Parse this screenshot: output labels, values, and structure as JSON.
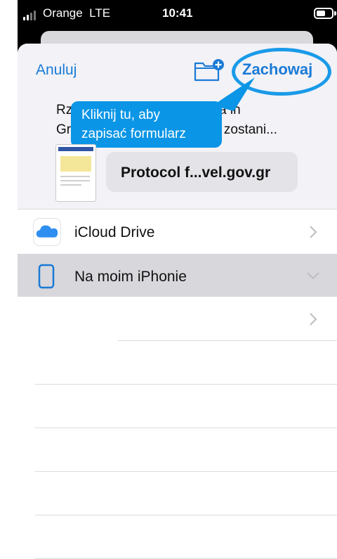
{
  "status_bar": {
    "carrier": "Orange",
    "network": "LTE",
    "time": "10:41"
  },
  "header": {
    "cancel_label": "Anuluj",
    "save_label": "Zachowaj",
    "new_folder_icon": "folder-plus-icon"
  },
  "file": {
    "name_line1_start": "Rz",
    "name_line1_end": "a  in",
    "name_line2_start": "Gr",
    "name_line2_end": "f” zostani...",
    "source_pill": "Protocol f...vel.gov.gr"
  },
  "tooltip": {
    "line1": "Kliknij tu, aby",
    "line2": "zapisać formularz"
  },
  "locations": [
    {
      "label": "iCloud Drive",
      "icon": "icloud-icon",
      "chevron": "chevron-right-icon"
    },
    {
      "label": "Na moim iPhonie",
      "icon": "iphone-icon",
      "chevron": "chevron-down-icon",
      "selected": true
    },
    {
      "label": "",
      "chevron": "chevron-right-icon"
    }
  ],
  "colors": {
    "accent": "#1a7ad6",
    "tooltip": "#0a95e6",
    "highlight_ring": "#1a9ae8",
    "selected_row": "#d7d7dc"
  }
}
